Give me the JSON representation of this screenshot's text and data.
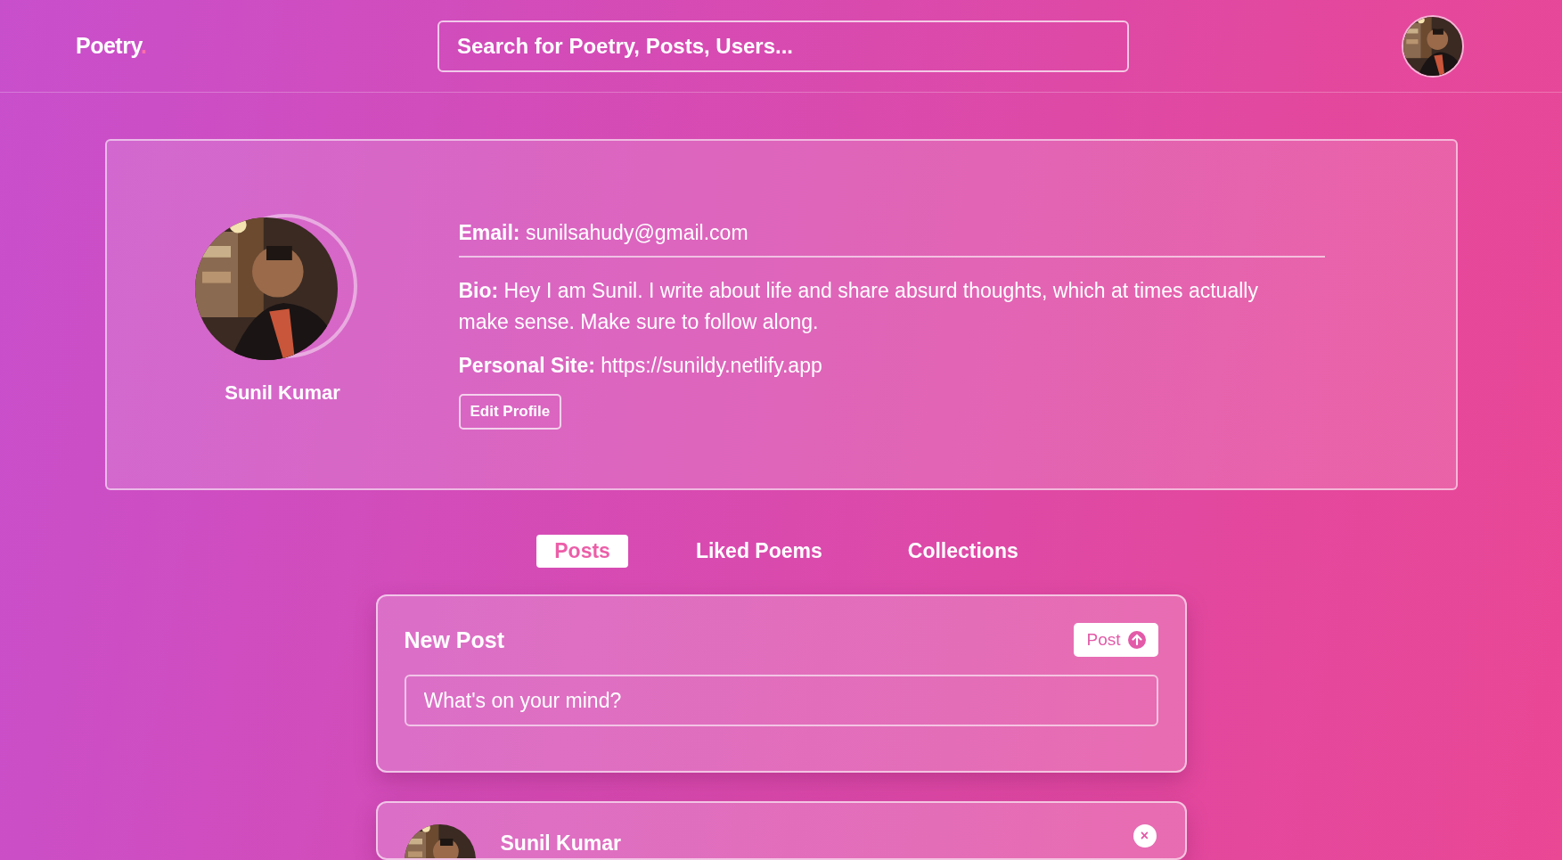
{
  "header": {
    "logo": "Poetry",
    "logo_mark": ".",
    "search": {
      "placeholder": "Search for Poetry, Posts, Users..."
    }
  },
  "profile": {
    "name": "Sunil Kumar",
    "fields": [
      {
        "label": "Email:",
        "value": "sunilsahudy@gmail.com",
        "divider": true
      },
      {
        "label": "Bio:",
        "value": "Hey I am Sunil. I write about life and share absurd thoughts, which at times actually make sense. Make sure to follow along.",
        "divider": false
      },
      {
        "label": "Personal Site:",
        "value": "https://sunildy.netlify.app",
        "divider": false
      }
    ],
    "edit_button": "Edit Profile"
  },
  "tabs": [
    {
      "label": "Posts",
      "selected": true
    },
    {
      "label": "Liked Poems",
      "selected": false
    },
    {
      "label": "Collections",
      "selected": false
    }
  ],
  "new_post": {
    "title": "New Post",
    "button": "Post",
    "input": {
      "placeholder": "What's on your mind?"
    }
  },
  "posts": [
    {
      "author": "Sunil Kumar",
      "close": "×"
    }
  ]
}
